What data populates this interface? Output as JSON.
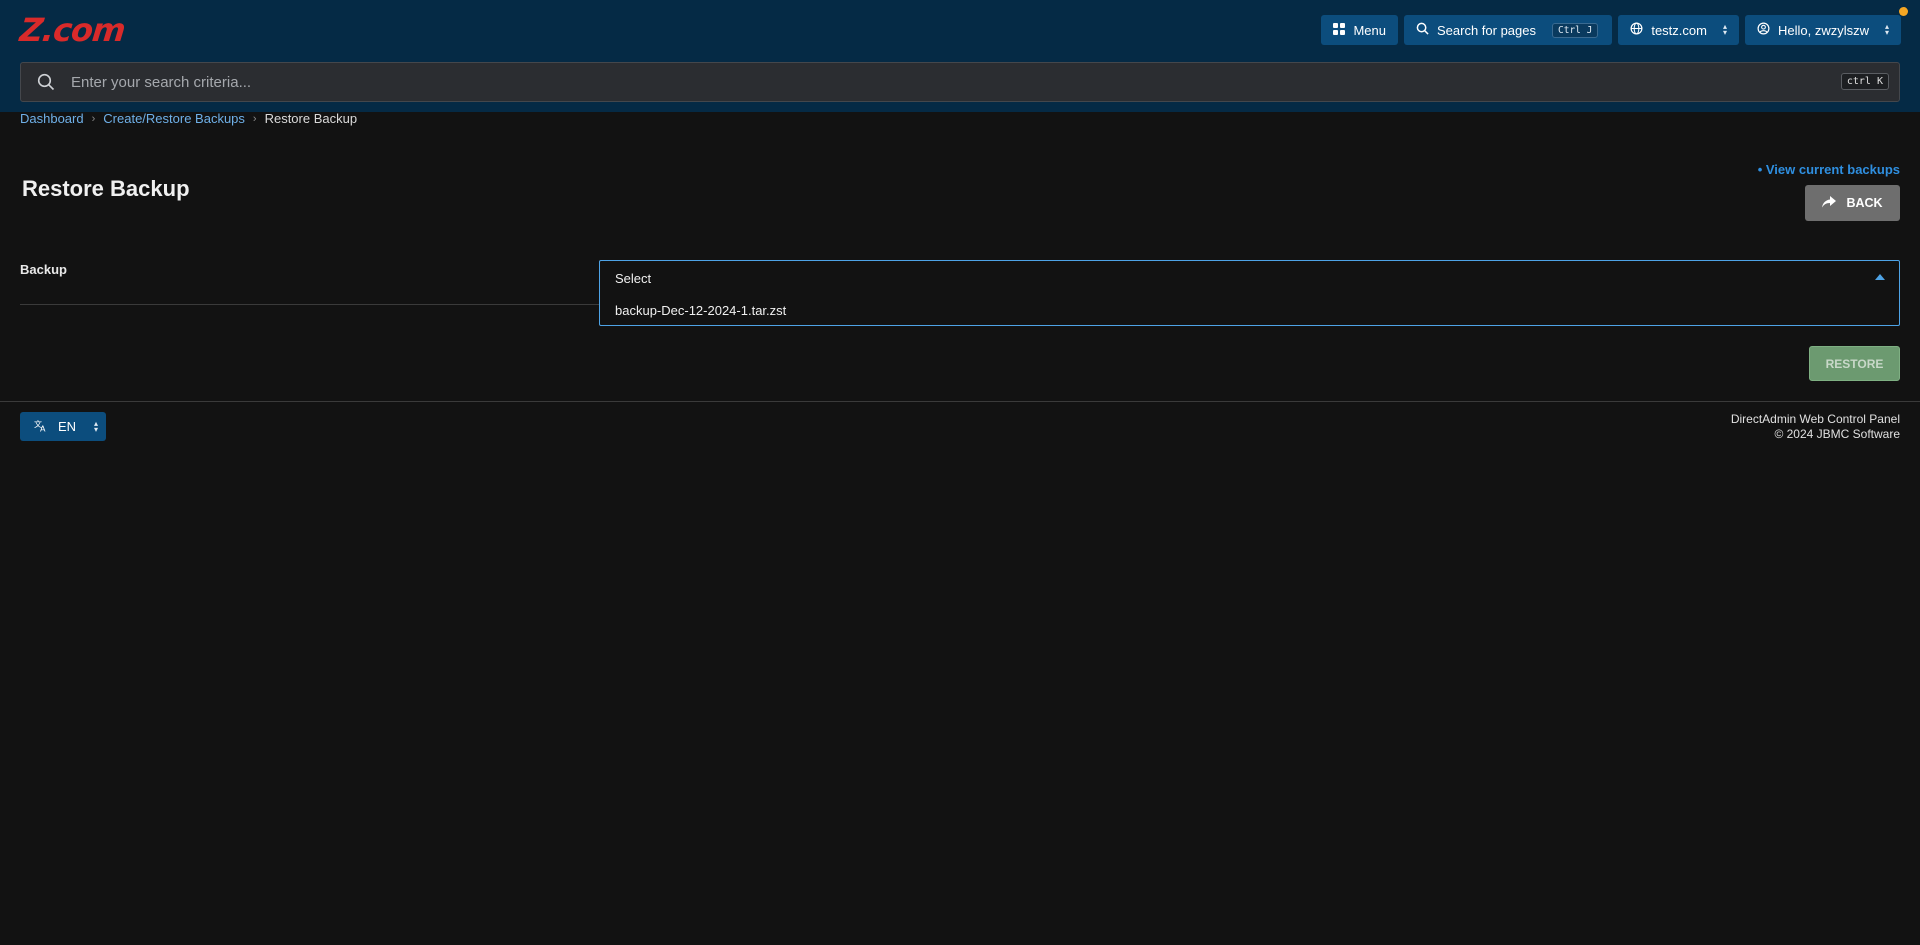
{
  "header": {
    "logo_text": "Z.com",
    "menu_label": "Menu",
    "search_pages_label": "Search for pages",
    "search_pages_shortcut": "Ctrl J",
    "domain_label": "testz.com",
    "user_label": "Hello, zwzylszw",
    "brand_color": "#d92a2a",
    "notification_color": "#f5a623"
  },
  "search": {
    "placeholder": "Enter your search criteria...",
    "shortcut": "ctrl K"
  },
  "breadcrumb": {
    "items": [
      "Dashboard",
      "Create/Restore Backups"
    ],
    "current": "Restore Backup"
  },
  "page": {
    "title": "Restore Backup",
    "view_link": "• View current backups",
    "back_label": "BACK"
  },
  "form": {
    "backup_label": "Backup",
    "select_value": "Select",
    "options": [
      "backup-Dec-12-2024-1.tar.zst"
    ],
    "restore_label": "RESTORE"
  },
  "footer": {
    "language": "EN",
    "line1": "DirectAdmin Web Control Panel",
    "line2": "© 2024 JBMC Software"
  }
}
